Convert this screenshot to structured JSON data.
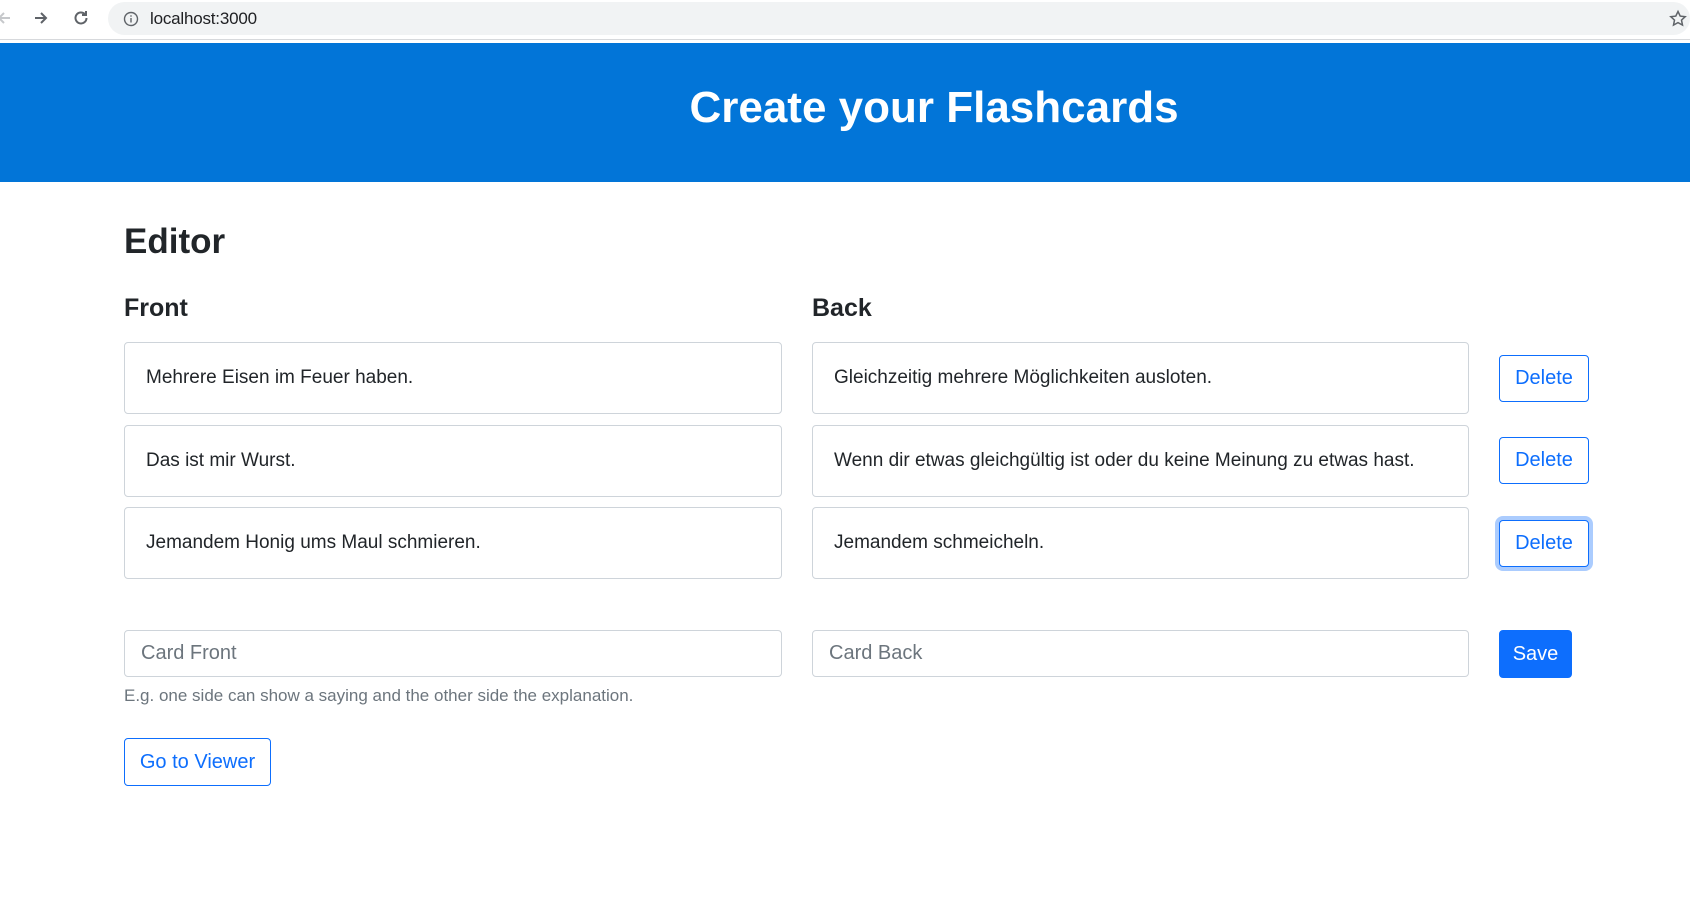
{
  "browser": {
    "url": "localhost:3000"
  },
  "header": {
    "title": "Create your Flashcards",
    "background": "#0275d8"
  },
  "editor": {
    "title": "Editor",
    "front_heading": "Front",
    "back_heading": "Back",
    "cards": [
      {
        "front": "Mehrere Eisen im Feuer haben.",
        "back": "Gleichzeitig mehrere Möglichkeiten ausloten.",
        "delete_label": "Delete"
      },
      {
        "front": "Das ist mir Wurst.",
        "back": "Wenn dir etwas gleichgültig ist oder du keine Meinung zu etwas hast.",
        "delete_label": "Delete"
      },
      {
        "front": "Jemandem Honig ums Maul schmieren.",
        "back": "Jemandem schmeicheln.",
        "delete_label": "Delete"
      }
    ],
    "new_card": {
      "front_placeholder": "Card Front",
      "back_placeholder": "Card Back",
      "save_label": "Save",
      "help_text": "E.g. one side can show a saying and the other side the explanation."
    },
    "viewer_label": "Go to Viewer"
  },
  "colors": {
    "primary": "#0d6efd",
    "border": "#ced4da",
    "muted_text": "#6c757d"
  }
}
